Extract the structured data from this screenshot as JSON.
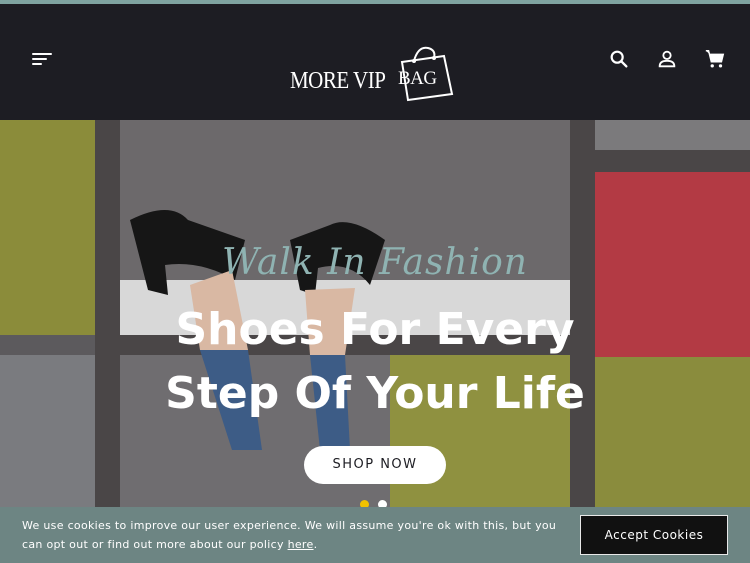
{
  "header": {
    "logo_text": "MORE VIP",
    "logo_bag_text": "BAG",
    "icons": [
      "menu-icon",
      "search-icon",
      "user-icon",
      "cart-icon"
    ]
  },
  "hero": {
    "tagline": "Walk In Fashion",
    "title_line1": "Shoes For Every",
    "title_line2": "Step Of Your Life",
    "cta_label": "SHOP NOW",
    "slides_total": 2,
    "active_slide": 1
  },
  "cookie": {
    "message": "We use cookies to improve our user experience. We will assume you're ok with this, but you can opt out or find out more about our policy ",
    "link_text": "here",
    "suffix": ".",
    "accept_label": "Accept Cookies"
  },
  "colors": {
    "header_bg": "#1d1d23",
    "accent_teal": "#8fb3b2",
    "cookie_bg": "#6d8583",
    "dot_active": "#f2c200"
  }
}
